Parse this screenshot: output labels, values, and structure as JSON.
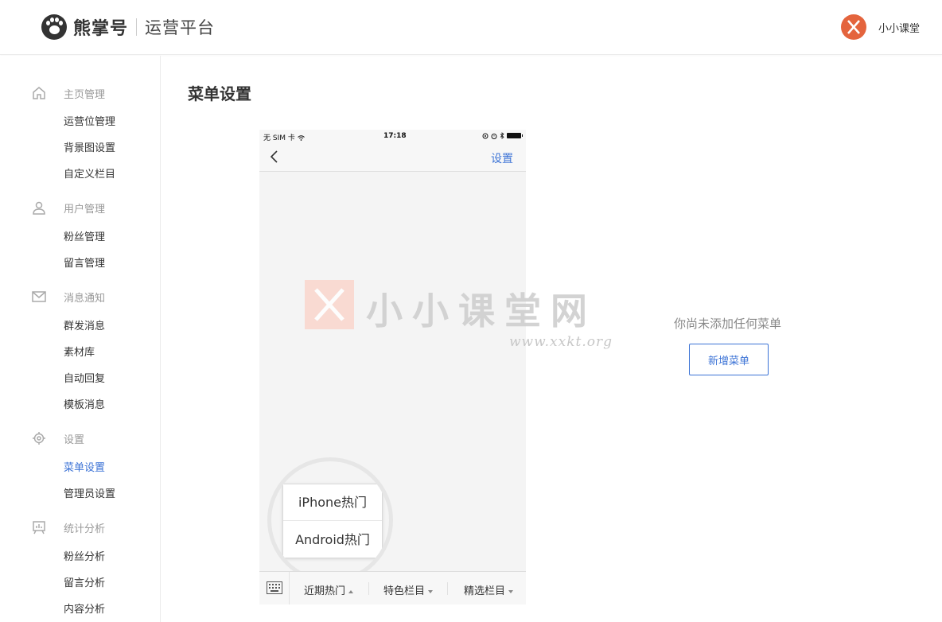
{
  "header": {
    "brand": "熊掌号",
    "brand_sub": "运营平台",
    "user_name": "小小课堂"
  },
  "sidebar": {
    "groups": [
      {
        "title": "主页管理",
        "icon": "home-icon",
        "items": [
          "运营位管理",
          "背景图设置",
          "自定义栏目"
        ]
      },
      {
        "title": "用户管理",
        "icon": "user-icon",
        "items": [
          "粉丝管理",
          "留言管理"
        ]
      },
      {
        "title": "消息通知",
        "icon": "mail-icon",
        "items": [
          "群发消息",
          "素材库",
          "自动回复",
          "模板消息"
        ]
      },
      {
        "title": "设置",
        "icon": "gear-icon",
        "items": [
          "菜单设置",
          "管理员设置"
        ]
      },
      {
        "title": "统计分析",
        "icon": "chart-icon",
        "items": [
          "粉丝分析",
          "留言分析",
          "内容分析"
        ]
      }
    ],
    "active_item": "菜单设置"
  },
  "main": {
    "page_title": "菜单设置",
    "empty_text": "你尚未添加任何菜单",
    "add_button": "新增菜单"
  },
  "phone": {
    "status_left": "无 SIM 卡",
    "status_time": "17:18",
    "nav_right": "设置",
    "popup_items": [
      "iPhone热门",
      "Android热门"
    ],
    "tabs": [
      "近期热门",
      "特色栏目",
      "精选栏目"
    ]
  },
  "watermark": {
    "text": "小小课堂网",
    "url": "www.xxkt.org"
  },
  "colors": {
    "accent": "#3c73d6",
    "avatar": "#e4643d"
  }
}
